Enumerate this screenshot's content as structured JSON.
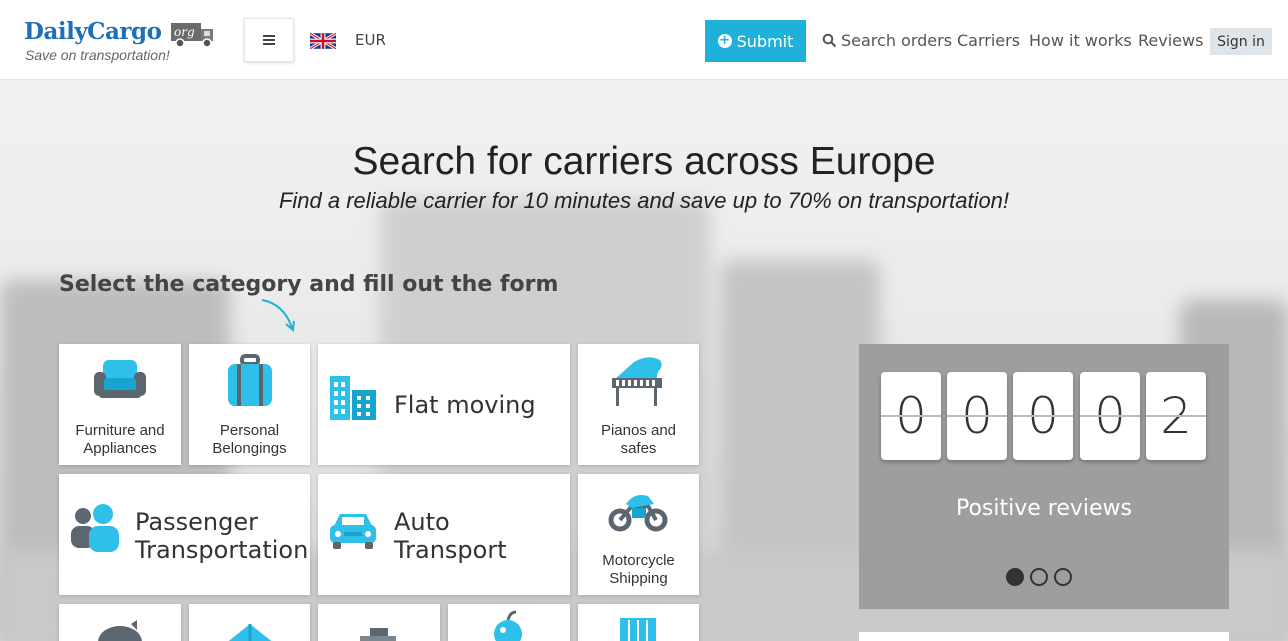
{
  "header": {
    "logo_name": "DailyCargo",
    "logo_badge": "org",
    "logo_tagline": "Save on transportation!",
    "currency": "EUR",
    "submit_label": "Submit",
    "nav": {
      "search_orders": "Search orders",
      "carriers": "Carriers",
      "how_it_works": "How it works",
      "reviews": "Reviews"
    },
    "signin_label": "Sign in"
  },
  "hero": {
    "title": "Search for carriers across Europe",
    "subtitle": "Find a reliable carrier for 10 minutes and save up to 70% on transportation!",
    "select_heading": "Select the category and fill out the form"
  },
  "categories": [
    {
      "label_line1": "Furniture and",
      "label_line2": "Appliances",
      "icon": "armchair-icon"
    },
    {
      "label_line1": "Personal",
      "label_line2": "Belongings",
      "icon": "suitcase-icon"
    },
    {
      "label": "Flat moving",
      "icon": "buildings-icon"
    },
    {
      "label_line1": "Pianos and",
      "label_line2": "safes",
      "icon": "piano-icon"
    },
    {
      "label_line1": "Passenger",
      "label_line2": "Transportation",
      "icon": "people-icon"
    },
    {
      "label_line1": "Auto",
      "label_line2": "Transport",
      "icon": "car-icon"
    },
    {
      "label_line1": "Motorcycle",
      "label_line2": "Shipping",
      "icon": "motorcycle-icon"
    },
    {
      "icon": "piggy-bank-icon"
    },
    {
      "icon": "tent-icon"
    },
    {
      "icon": "package-icon"
    },
    {
      "icon": "apple-icon"
    },
    {
      "icon": "crate-icon"
    }
  ],
  "reviews_counter": {
    "digits": [
      "0",
      "0",
      "0",
      "0",
      "2"
    ],
    "label": "Positive reviews",
    "active_slide": 1,
    "slides": 3
  },
  "colors": {
    "accent": "#1fb1d9",
    "logo_blue": "#1f6fb6",
    "icon_dark": "#5c6670"
  }
}
